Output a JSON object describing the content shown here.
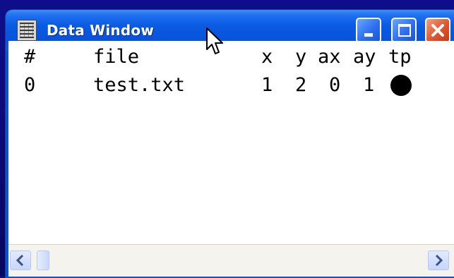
{
  "window": {
    "title": "Data Window",
    "icon": "data-table-icon"
  },
  "table": {
    "columns": [
      "#",
      "file",
      "x",
      "y",
      "ax",
      "ay",
      "tp"
    ],
    "rows": [
      {
        "index": "0",
        "file": "test.txt",
        "x": "1",
        "y": "2",
        "ax": "0",
        "ay": "1",
        "tp": "filled-circle-marker"
      }
    ]
  },
  "scrollbar": {
    "left_icon": "chevron-left-icon",
    "right_icon": "chevron-right-icon"
  },
  "colors": {
    "titlebar": "#0853dc",
    "close_button": "#e0552d",
    "client_background": "#ffffff",
    "desktop": "#0d0d80"
  }
}
